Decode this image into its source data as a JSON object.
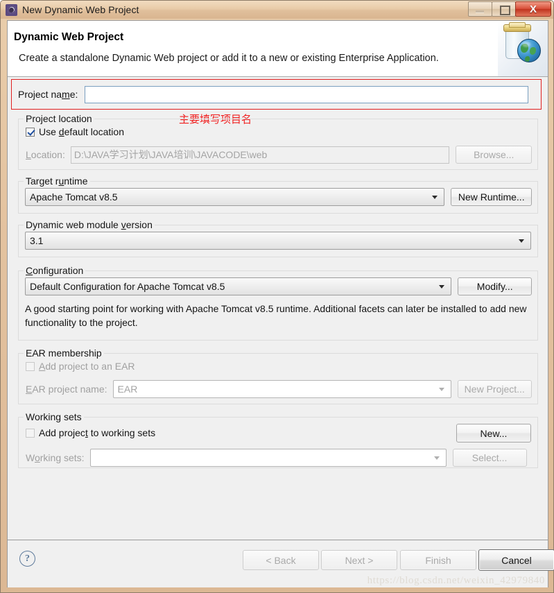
{
  "window": {
    "title": "New Dynamic Web Project",
    "icon": "eclipse-project-icon",
    "controls": {
      "minimize": "minimize-icon",
      "maximize": "maximize-icon",
      "close": "X"
    }
  },
  "banner": {
    "title": "Dynamic Web Project",
    "description": "Create a standalone Dynamic Web project or add it to a new or existing Enterprise Application.",
    "icon": "dynamic-web-project-jar-globe-icon"
  },
  "annotation": {
    "note": "主要填写项目名",
    "color": "#f01c1c"
  },
  "form": {
    "project_name": {
      "label": "Project name:",
      "value": "",
      "placeholder": ""
    },
    "project_location": {
      "legend": "Project location",
      "use_default_label": "Use default location",
      "use_default_checked": true,
      "location_label": "Location:",
      "location_value": "D:\\JAVA学习计划\\JAVA培训\\JAVACODE\\web",
      "browse_label": "Browse..."
    },
    "target_runtime": {
      "legend": "Target runtime",
      "value": "Apache Tomcat v8.5",
      "new_runtime_label": "New Runtime..."
    },
    "module_version": {
      "legend": "Dynamic web module version",
      "value": "3.1"
    },
    "configuration": {
      "legend": "Configuration",
      "value": "Default Configuration for Apache Tomcat v8.5",
      "modify_label": "Modify...",
      "description": "A good starting point for working with Apache Tomcat v8.5 runtime. Additional facets can later be installed to add new functionality to the project."
    },
    "ear_membership": {
      "legend": "EAR membership",
      "add_to_ear_label": "Add project to an EAR",
      "add_to_ear_checked": false,
      "ear_project_name_label": "EAR project name:",
      "ear_project_name_value": "EAR",
      "new_project_label": "New Project..."
    },
    "working_sets": {
      "legend": "Working sets",
      "add_to_working_sets_label": "Add project to working sets",
      "add_to_working_sets_checked": false,
      "new_label": "New...",
      "working_sets_label": "Working sets:",
      "working_sets_value": "",
      "select_label": "Select..."
    }
  },
  "footer": {
    "help": "?",
    "back": "< Back",
    "next": "Next >",
    "finish": "Finish",
    "cancel": "Cancel",
    "watermark": "https://blog.csdn.net/weixin_42979840"
  }
}
